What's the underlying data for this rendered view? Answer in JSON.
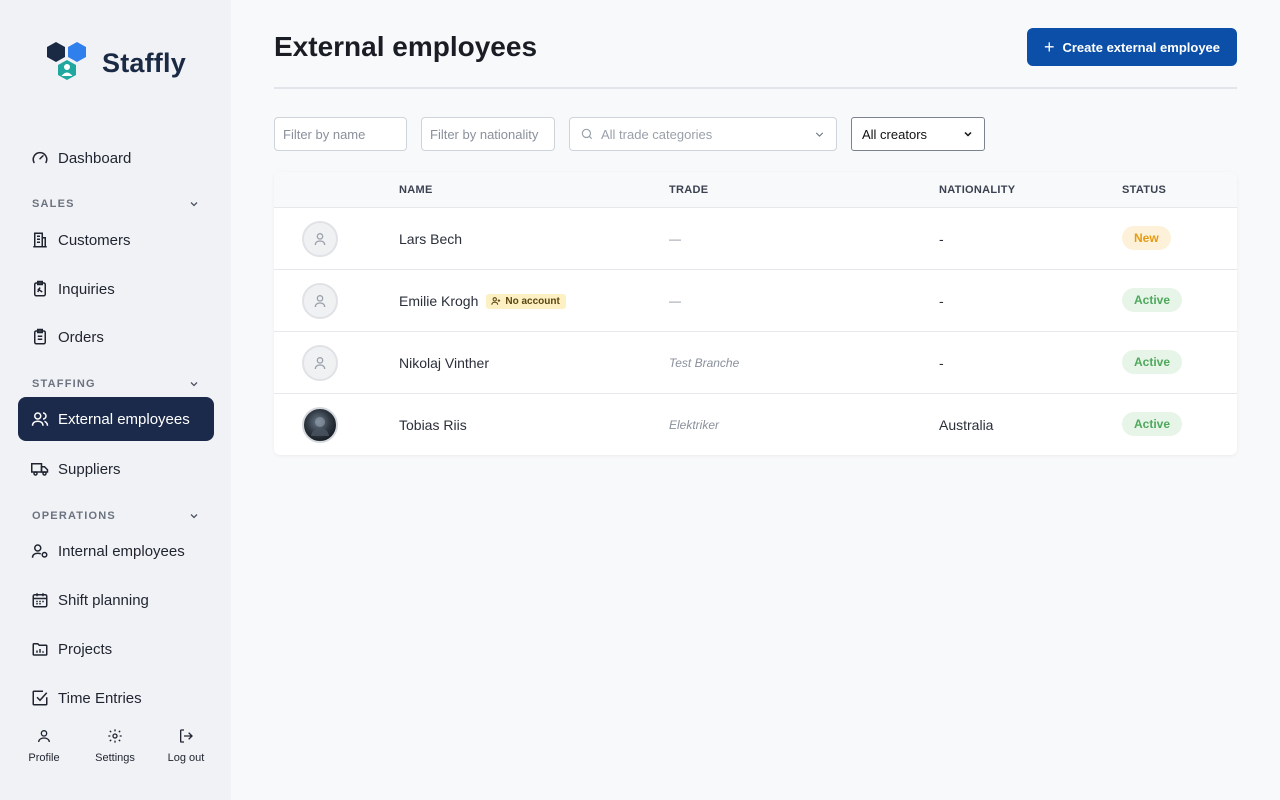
{
  "app": {
    "name": "Staffly"
  },
  "sidebar": {
    "dashboard": "Dashboard",
    "sections": [
      {
        "label": "SALES",
        "items": [
          "Customers",
          "Inquiries",
          "Orders"
        ]
      },
      {
        "label": "STAFFING",
        "items": [
          "External employees",
          "Suppliers"
        ]
      },
      {
        "label": "OPERATIONS",
        "items": [
          "Internal employees",
          "Shift planning",
          "Projects",
          "Time Entries"
        ]
      }
    ],
    "active_item": "External employees",
    "bottom": {
      "profile": "Profile",
      "settings": "Settings",
      "logout": "Log out"
    }
  },
  "header": {
    "title": "External employees",
    "create_button": "Create external employee"
  },
  "filters": {
    "name_placeholder": "Filter by name",
    "nationality_placeholder": "Filter by nationality",
    "trade_placeholder": "All trade categories",
    "creators_selected": "All creators"
  },
  "table": {
    "columns": [
      "NAME",
      "TRADE",
      "NATIONALITY",
      "STATUS"
    ],
    "rows": [
      {
        "name": "Lars Bech",
        "trade": "—",
        "nationality": "-",
        "status": "New",
        "avatar": "placeholder"
      },
      {
        "name": "Emilie Krogh",
        "badge": "No account",
        "trade": "—",
        "nationality": "-",
        "status": "Active",
        "avatar": "placeholder"
      },
      {
        "name": "Nikolaj Vinther",
        "trade": "Test Branche",
        "nationality": "-",
        "status": "Active",
        "avatar": "placeholder"
      },
      {
        "name": "Tobias Riis",
        "trade": "Elektriker",
        "nationality": "Australia",
        "status": "Active",
        "avatar": "photo"
      }
    ]
  },
  "colors": {
    "primary": "#0b4fa8",
    "sidebar_active": "#1b2a4a",
    "status_new": "#e69b12",
    "status_active": "#4fa85c",
    "logo_dark": "#1b2a44",
    "logo_blue": "#2f80ed",
    "logo_teal": "#1fa7a0"
  }
}
